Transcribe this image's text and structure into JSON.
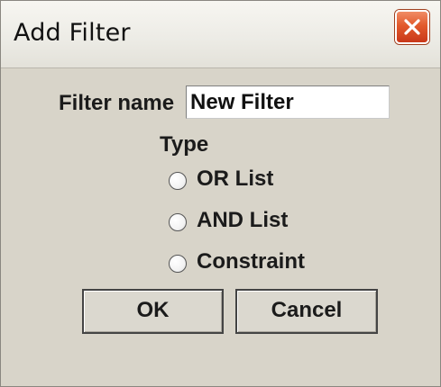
{
  "window": {
    "title": "Add Filter",
    "close_icon": "close-x-icon"
  },
  "form": {
    "filter_name_label": "Filter name",
    "filter_name_value": "New Filter",
    "type_label": "Type",
    "type_options": [
      {
        "label": "OR List",
        "selected": false
      },
      {
        "label": "AND List",
        "selected": false
      },
      {
        "label": "Constraint",
        "selected": false
      }
    ]
  },
  "buttons": {
    "ok_label": "OK",
    "cancel_label": "Cancel"
  },
  "colors": {
    "dialog_bg": "#d8d4c9",
    "close_button": "#e25a2c"
  }
}
